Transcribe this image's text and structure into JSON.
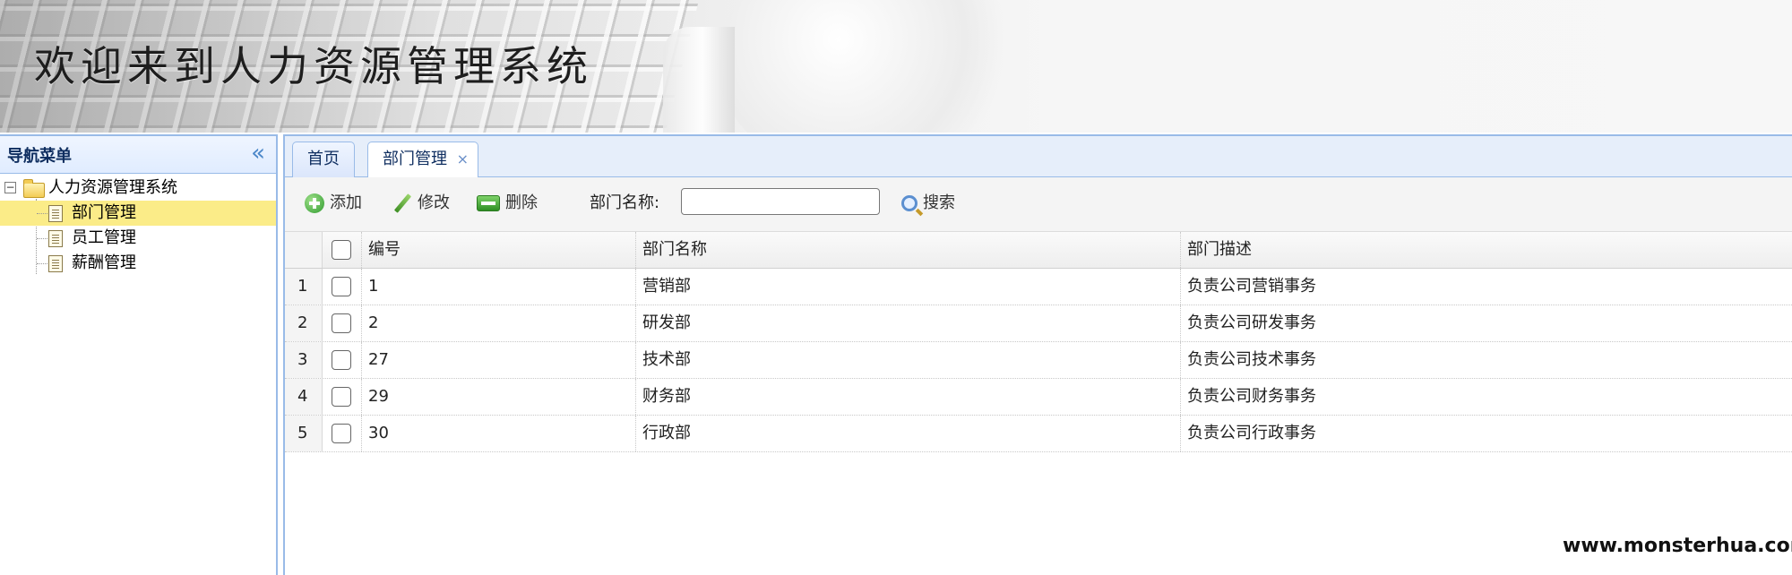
{
  "banner": {
    "title": "欢迎来到人力资源管理系统"
  },
  "nav": {
    "title": "导航菜单",
    "collapse_glyph": "«",
    "root": {
      "label": "人力资源管理系统",
      "toggle": "−"
    },
    "items": [
      {
        "label": "部门管理",
        "selected": true
      },
      {
        "label": "员工管理",
        "selected": false
      },
      {
        "label": "薪酬管理",
        "selected": false
      }
    ]
  },
  "tabs": [
    {
      "label": "首页",
      "active": false
    },
    {
      "label": "部门管理",
      "active": true,
      "close": "×"
    }
  ],
  "toolbar": {
    "add_label": "添加",
    "edit_label": "修改",
    "delete_label": "删除",
    "search_label": "部门名称:",
    "search_value": "",
    "search_button": "搜索"
  },
  "grid": {
    "columns": [
      "编号",
      "部门名称",
      "部门描述"
    ],
    "rows": [
      {
        "n": "1",
        "id": "1",
        "name": "营销部",
        "desc": "负责公司营销事务"
      },
      {
        "n": "2",
        "id": "2",
        "name": "研发部",
        "desc": "负责公司研发事务"
      },
      {
        "n": "3",
        "id": "27",
        "name": "技术部",
        "desc": "负责公司技术事务"
      },
      {
        "n": "4",
        "id": "29",
        "name": "财务部",
        "desc": "负责公司财务事务"
      },
      {
        "n": "5",
        "id": "30",
        "name": "行政部",
        "desc": "负责公司行政事务"
      }
    ]
  },
  "watermark": "www.monsterhua.com",
  "colors": {
    "panel_border": "#99bbe8",
    "selected_row": "#fbec88",
    "header_text": "#0e2d5f"
  }
}
